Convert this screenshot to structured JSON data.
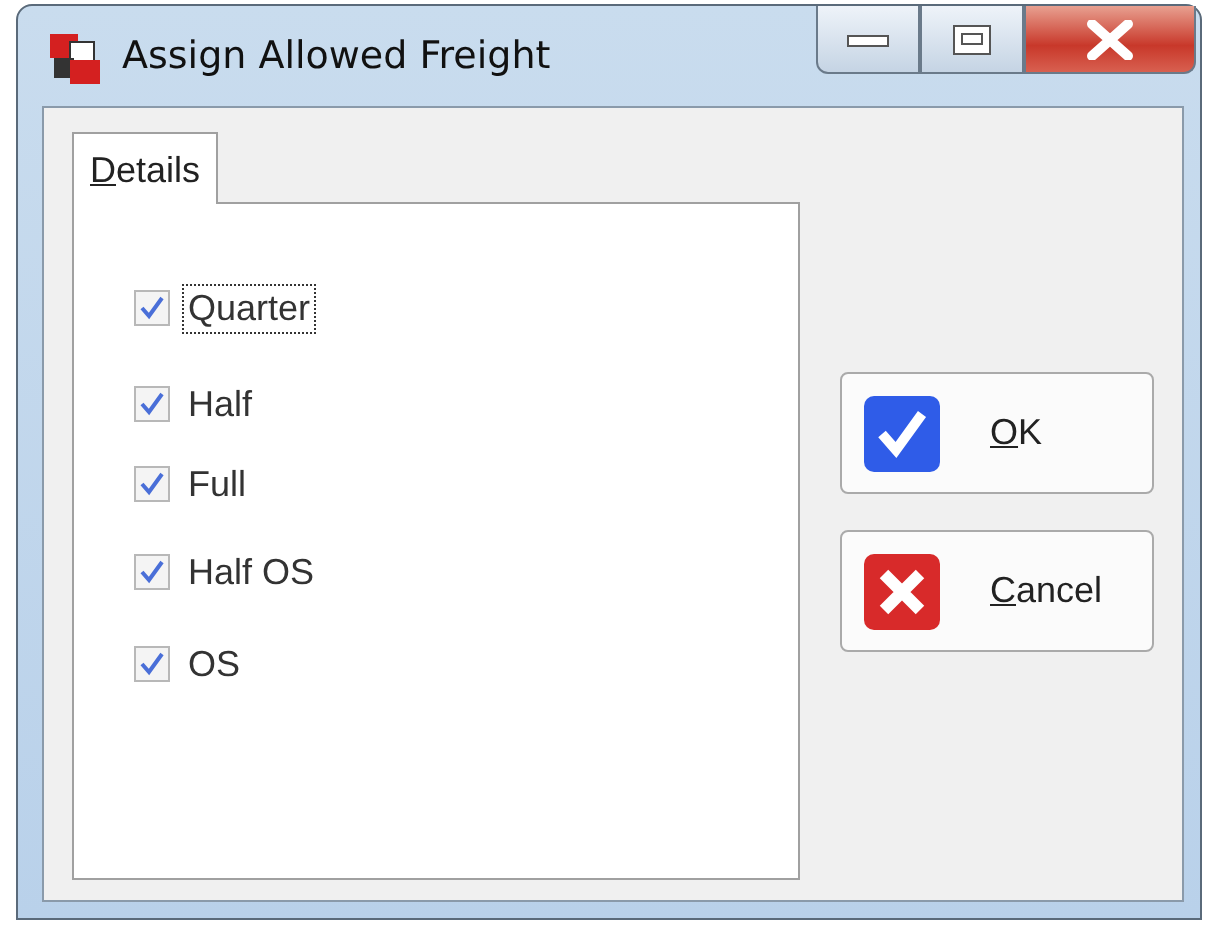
{
  "window": {
    "title": "Assign Allowed Freight"
  },
  "tabs": [
    {
      "label": "Details",
      "selected": true
    }
  ],
  "options": [
    {
      "label": "Quarter",
      "checked": true,
      "focused": true
    },
    {
      "label": "Half",
      "checked": true,
      "focused": false
    },
    {
      "label": "Full",
      "checked": true,
      "focused": false
    },
    {
      "label": "Half OS",
      "checked": true,
      "focused": false
    },
    {
      "label": "OS",
      "checked": true,
      "focused": false
    }
  ],
  "buttons": [
    {
      "label": "OK",
      "kind": "ok"
    },
    {
      "label": "Cancel",
      "kind": "cancel"
    }
  ]
}
